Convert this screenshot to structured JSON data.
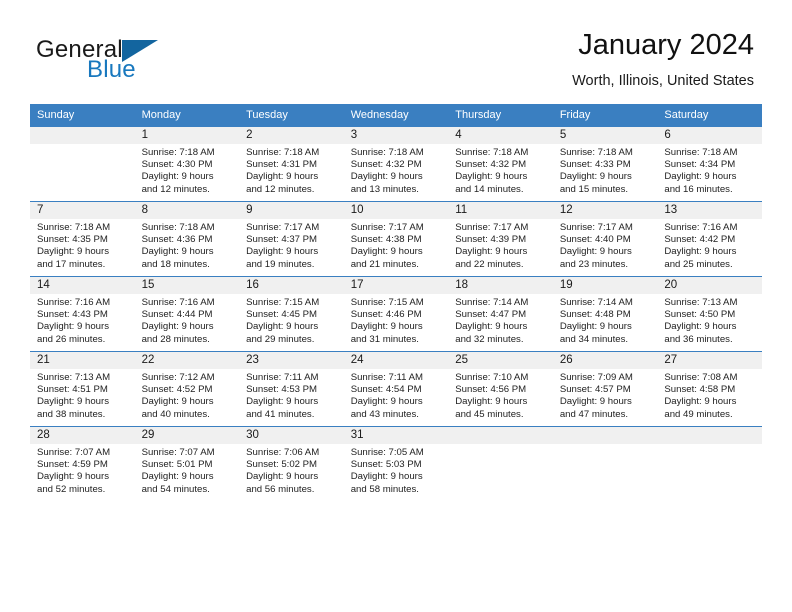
{
  "brand": {
    "general": "General",
    "blue": "Blue",
    "triangle_color": "#13659f",
    "blue_color": "#1878be"
  },
  "header": {
    "title": "January 2024",
    "location": "Worth, Illinois, United States",
    "header_bg": "#3a7fc1",
    "daynum_bg": "#f0f0f0"
  },
  "weekday_headers": [
    "Sunday",
    "Monday",
    "Tuesday",
    "Wednesday",
    "Thursday",
    "Friday",
    "Saturday"
  ],
  "weeks": [
    [
      {
        "day": "",
        "sunrise": "",
        "sunset": "",
        "daylight1": "",
        "daylight2": ""
      },
      {
        "day": "1",
        "sunrise": "Sunrise: 7:18 AM",
        "sunset": "Sunset: 4:30 PM",
        "daylight1": "Daylight: 9 hours",
        "daylight2": "and 12 minutes."
      },
      {
        "day": "2",
        "sunrise": "Sunrise: 7:18 AM",
        "sunset": "Sunset: 4:31 PM",
        "daylight1": "Daylight: 9 hours",
        "daylight2": "and 12 minutes."
      },
      {
        "day": "3",
        "sunrise": "Sunrise: 7:18 AM",
        "sunset": "Sunset: 4:32 PM",
        "daylight1": "Daylight: 9 hours",
        "daylight2": "and 13 minutes."
      },
      {
        "day": "4",
        "sunrise": "Sunrise: 7:18 AM",
        "sunset": "Sunset: 4:32 PM",
        "daylight1": "Daylight: 9 hours",
        "daylight2": "and 14 minutes."
      },
      {
        "day": "5",
        "sunrise": "Sunrise: 7:18 AM",
        "sunset": "Sunset: 4:33 PM",
        "daylight1": "Daylight: 9 hours",
        "daylight2": "and 15 minutes."
      },
      {
        "day": "6",
        "sunrise": "Sunrise: 7:18 AM",
        "sunset": "Sunset: 4:34 PM",
        "daylight1": "Daylight: 9 hours",
        "daylight2": "and 16 minutes."
      }
    ],
    [
      {
        "day": "7",
        "sunrise": "Sunrise: 7:18 AM",
        "sunset": "Sunset: 4:35 PM",
        "daylight1": "Daylight: 9 hours",
        "daylight2": "and 17 minutes."
      },
      {
        "day": "8",
        "sunrise": "Sunrise: 7:18 AM",
        "sunset": "Sunset: 4:36 PM",
        "daylight1": "Daylight: 9 hours",
        "daylight2": "and 18 minutes."
      },
      {
        "day": "9",
        "sunrise": "Sunrise: 7:17 AM",
        "sunset": "Sunset: 4:37 PM",
        "daylight1": "Daylight: 9 hours",
        "daylight2": "and 19 minutes."
      },
      {
        "day": "10",
        "sunrise": "Sunrise: 7:17 AM",
        "sunset": "Sunset: 4:38 PM",
        "daylight1": "Daylight: 9 hours",
        "daylight2": "and 21 minutes."
      },
      {
        "day": "11",
        "sunrise": "Sunrise: 7:17 AM",
        "sunset": "Sunset: 4:39 PM",
        "daylight1": "Daylight: 9 hours",
        "daylight2": "and 22 minutes."
      },
      {
        "day": "12",
        "sunrise": "Sunrise: 7:17 AM",
        "sunset": "Sunset: 4:40 PM",
        "daylight1": "Daylight: 9 hours",
        "daylight2": "and 23 minutes."
      },
      {
        "day": "13",
        "sunrise": "Sunrise: 7:16 AM",
        "sunset": "Sunset: 4:42 PM",
        "daylight1": "Daylight: 9 hours",
        "daylight2": "and 25 minutes."
      }
    ],
    [
      {
        "day": "14",
        "sunrise": "Sunrise: 7:16 AM",
        "sunset": "Sunset: 4:43 PM",
        "daylight1": "Daylight: 9 hours",
        "daylight2": "and 26 minutes."
      },
      {
        "day": "15",
        "sunrise": "Sunrise: 7:16 AM",
        "sunset": "Sunset: 4:44 PM",
        "daylight1": "Daylight: 9 hours",
        "daylight2": "and 28 minutes."
      },
      {
        "day": "16",
        "sunrise": "Sunrise: 7:15 AM",
        "sunset": "Sunset: 4:45 PM",
        "daylight1": "Daylight: 9 hours",
        "daylight2": "and 29 minutes."
      },
      {
        "day": "17",
        "sunrise": "Sunrise: 7:15 AM",
        "sunset": "Sunset: 4:46 PM",
        "daylight1": "Daylight: 9 hours",
        "daylight2": "and 31 minutes."
      },
      {
        "day": "18",
        "sunrise": "Sunrise: 7:14 AM",
        "sunset": "Sunset: 4:47 PM",
        "daylight1": "Daylight: 9 hours",
        "daylight2": "and 32 minutes."
      },
      {
        "day": "19",
        "sunrise": "Sunrise: 7:14 AM",
        "sunset": "Sunset: 4:48 PM",
        "daylight1": "Daylight: 9 hours",
        "daylight2": "and 34 minutes."
      },
      {
        "day": "20",
        "sunrise": "Sunrise: 7:13 AM",
        "sunset": "Sunset: 4:50 PM",
        "daylight1": "Daylight: 9 hours",
        "daylight2": "and 36 minutes."
      }
    ],
    [
      {
        "day": "21",
        "sunrise": "Sunrise: 7:13 AM",
        "sunset": "Sunset: 4:51 PM",
        "daylight1": "Daylight: 9 hours",
        "daylight2": "and 38 minutes."
      },
      {
        "day": "22",
        "sunrise": "Sunrise: 7:12 AM",
        "sunset": "Sunset: 4:52 PM",
        "daylight1": "Daylight: 9 hours",
        "daylight2": "and 40 minutes."
      },
      {
        "day": "23",
        "sunrise": "Sunrise: 7:11 AM",
        "sunset": "Sunset: 4:53 PM",
        "daylight1": "Daylight: 9 hours",
        "daylight2": "and 41 minutes."
      },
      {
        "day": "24",
        "sunrise": "Sunrise: 7:11 AM",
        "sunset": "Sunset: 4:54 PM",
        "daylight1": "Daylight: 9 hours",
        "daylight2": "and 43 minutes."
      },
      {
        "day": "25",
        "sunrise": "Sunrise: 7:10 AM",
        "sunset": "Sunset: 4:56 PM",
        "daylight1": "Daylight: 9 hours",
        "daylight2": "and 45 minutes."
      },
      {
        "day": "26",
        "sunrise": "Sunrise: 7:09 AM",
        "sunset": "Sunset: 4:57 PM",
        "daylight1": "Daylight: 9 hours",
        "daylight2": "and 47 minutes."
      },
      {
        "day": "27",
        "sunrise": "Sunrise: 7:08 AM",
        "sunset": "Sunset: 4:58 PM",
        "daylight1": "Daylight: 9 hours",
        "daylight2": "and 49 minutes."
      }
    ],
    [
      {
        "day": "28",
        "sunrise": "Sunrise: 7:07 AM",
        "sunset": "Sunset: 4:59 PM",
        "daylight1": "Daylight: 9 hours",
        "daylight2": "and 52 minutes."
      },
      {
        "day": "29",
        "sunrise": "Sunrise: 7:07 AM",
        "sunset": "Sunset: 5:01 PM",
        "daylight1": "Daylight: 9 hours",
        "daylight2": "and 54 minutes."
      },
      {
        "day": "30",
        "sunrise": "Sunrise: 7:06 AM",
        "sunset": "Sunset: 5:02 PM",
        "daylight1": "Daylight: 9 hours",
        "daylight2": "and 56 minutes."
      },
      {
        "day": "31",
        "sunrise": "Sunrise: 7:05 AM",
        "sunset": "Sunset: 5:03 PM",
        "daylight1": "Daylight: 9 hours",
        "daylight2": "and 58 minutes."
      },
      {
        "day": "",
        "sunrise": "",
        "sunset": "",
        "daylight1": "",
        "daylight2": ""
      },
      {
        "day": "",
        "sunrise": "",
        "sunset": "",
        "daylight1": "",
        "daylight2": ""
      },
      {
        "day": "",
        "sunrise": "",
        "sunset": "",
        "daylight1": "",
        "daylight2": ""
      }
    ]
  ]
}
